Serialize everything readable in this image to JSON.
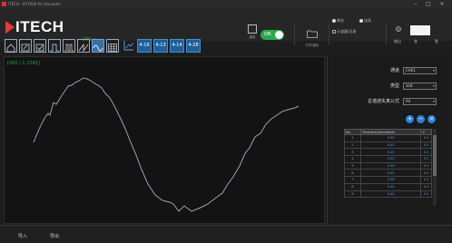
{
  "window": {
    "title": "ITECH - PV7000 PV Simulator",
    "controls": [
      "–",
      "□",
      "×"
    ]
  },
  "header": {
    "logo_text": "ITECH",
    "logo_sub": "Offline",
    "tools": [
      {
        "name": "save",
        "label": "保存"
      },
      {
        "name": "open",
        "label": "打开波形"
      }
    ],
    "toggle_label": "ON",
    "options": {
      "single": "单次",
      "repeat": "连续",
      "checkbox_label": "示波器/记录"
    },
    "right_labels": [
      "输出",
      "查",
      "看"
    ]
  },
  "toolbar": {
    "tabs": [
      "4-16",
      "4-13",
      "4-14",
      "4-28"
    ]
  },
  "plot": {
    "readout": "[000 / 2.2345]",
    "curve_color": "#8fa3b8"
  },
  "panel": {
    "channel_label": "通道",
    "channel_value": "CH01",
    "type_label": "类型",
    "type_value": "Volt",
    "formula_label": "总谐波失真公式",
    "formula_value": "All",
    "table_headers": [
      "No.",
      "Time(ms)/Amplitude",
      "V"
    ],
    "rows": [
      {
        "idx": "1",
        "a": "0.00",
        "b": "0.0"
      },
      {
        "idx": "2",
        "a": "0.00",
        "b": "0.0"
      },
      {
        "idx": "3",
        "a": "0.00",
        "b": "0.0"
      },
      {
        "idx": "4",
        "a": "0.00",
        "b": "0.0"
      },
      {
        "idx": "5",
        "a": "0.00",
        "b": "0.0"
      },
      {
        "idx": "6",
        "a": "0.00",
        "b": "0.0"
      },
      {
        "idx": "7",
        "a": "0.00",
        "b": "0.0"
      },
      {
        "idx": "8",
        "a": "0.00",
        "b": "0.0"
      },
      {
        "idx": "9",
        "a": "0.00",
        "b": "0.0"
      }
    ]
  },
  "footer": {
    "import_label": "导入",
    "export_label": "导出"
  },
  "colors": {
    "accent_blue": "#2b7fd6",
    "toggle_green": "#2ba84a",
    "logo_red": "#e23b3b"
  }
}
